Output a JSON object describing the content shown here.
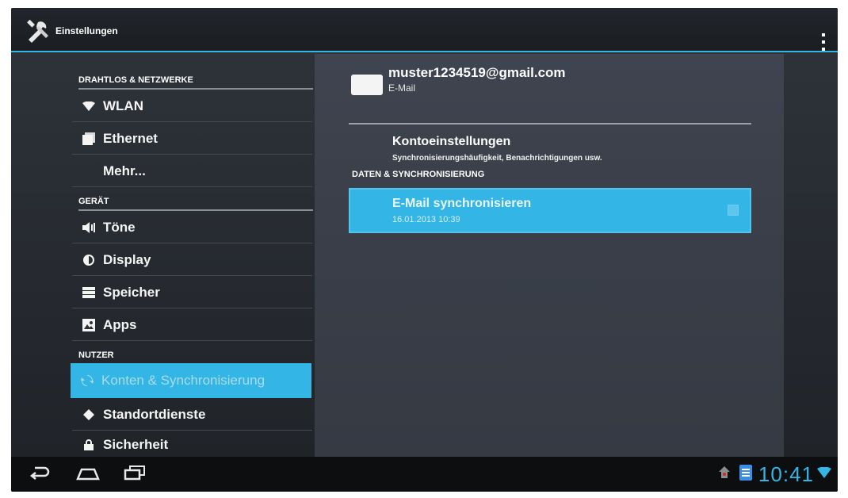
{
  "actionbar": {
    "title": "Einstellungen",
    "app_icon": "tools-icon",
    "overflow_icon": "overflow-menu-icon"
  },
  "sidebar": {
    "sections": [
      {
        "header": "DRAHTLOS & NETZWERKE"
      },
      {
        "header": "GERÄT"
      },
      {
        "header": "NUTZER"
      }
    ],
    "items": [
      {
        "label": "WLAN",
        "icon": "wifi-icon"
      },
      {
        "label": "Ethernet",
        "icon": "ethernet-icon"
      },
      {
        "label": "Mehr...",
        "icon": ""
      },
      {
        "label": "Töne",
        "icon": "speaker-icon"
      },
      {
        "label": "Display",
        "icon": "brightness-icon"
      },
      {
        "label": "Speicher",
        "icon": "storage-icon"
      },
      {
        "label": "Apps",
        "icon": "apps-icon"
      },
      {
        "label": "Konten & Synchronisierung",
        "icon": "sync-icon",
        "selected": true
      },
      {
        "label": "Standortdienste",
        "icon": "location-icon"
      },
      {
        "label": "Sicherheit",
        "icon": "lock-icon"
      }
    ]
  },
  "account": {
    "email": "muster1234519@gmail.com",
    "type": "E-Mail"
  },
  "settings": {
    "konto_title": "Kontoeinstellungen",
    "konto_subtitle": "Synchronisierungshäufigkeit, Benachrichtigungen usw.",
    "section_header": "DATEN & SYNCHRONISIERUNG",
    "sync_title": "E-Mail synchronisieren",
    "sync_time": "16.01.2013 10:39",
    "sync_checked": true
  },
  "statusbar": {
    "time": "10:41",
    "icons": [
      "notification-icon",
      "app-notification-icon",
      "wifi-signal-icon"
    ]
  },
  "navigation": {
    "buttons": [
      "back-icon",
      "home-icon",
      "recent-apps-icon"
    ]
  },
  "colors": {
    "accent": "#33b5e5",
    "background": "#2b2f36",
    "text": "#f2f2f2"
  }
}
